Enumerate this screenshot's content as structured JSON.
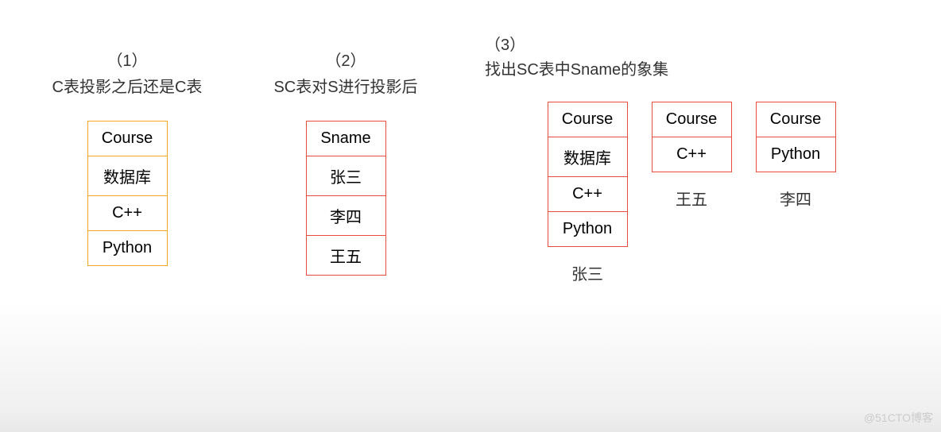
{
  "watermark": "@51CTO博客",
  "section1": {
    "num": "（1）",
    "title": "C表投影之后还是C表",
    "header": "Course",
    "rows": [
      "数据库",
      "C++",
      "Python"
    ]
  },
  "section2": {
    "num": "（2）",
    "title": "SC表对S进行投影后",
    "header": "Sname",
    "rows": [
      "张三",
      "李四",
      "王五"
    ]
  },
  "section3": {
    "num": "（3）",
    "title": "找出SC表中Sname的象集",
    "tables": [
      {
        "header": "Course",
        "rows": [
          "数据库",
          "C++",
          "Python"
        ],
        "caption": "张三"
      },
      {
        "header": "Course",
        "rows": [
          "C++"
        ],
        "caption": "王五"
      },
      {
        "header": "Course",
        "rows": [
          "Python"
        ],
        "caption": "李四"
      }
    ]
  },
  "chart_data": {
    "type": "table",
    "description": "Relational algebra division operation illustration",
    "c_table_projection": {
      "columns": [
        "Course"
      ],
      "rows": [
        [
          "数据库"
        ],
        [
          "C++"
        ],
        [
          "Python"
        ]
      ]
    },
    "sc_table_s_projection": {
      "columns": [
        "Sname"
      ],
      "rows": [
        [
          "张三"
        ],
        [
          "李四"
        ],
        [
          "王五"
        ]
      ]
    },
    "sname_image_sets": [
      {
        "sname": "张三",
        "columns": [
          "Course"
        ],
        "rows": [
          [
            "数据库"
          ],
          [
            "C++"
          ],
          [
            "Python"
          ]
        ]
      },
      {
        "sname": "王五",
        "columns": [
          "Course"
        ],
        "rows": [
          [
            "C++"
          ]
        ]
      },
      {
        "sname": "李四",
        "columns": [
          "Course"
        ],
        "rows": [
          [
            "Python"
          ]
        ]
      }
    ]
  }
}
